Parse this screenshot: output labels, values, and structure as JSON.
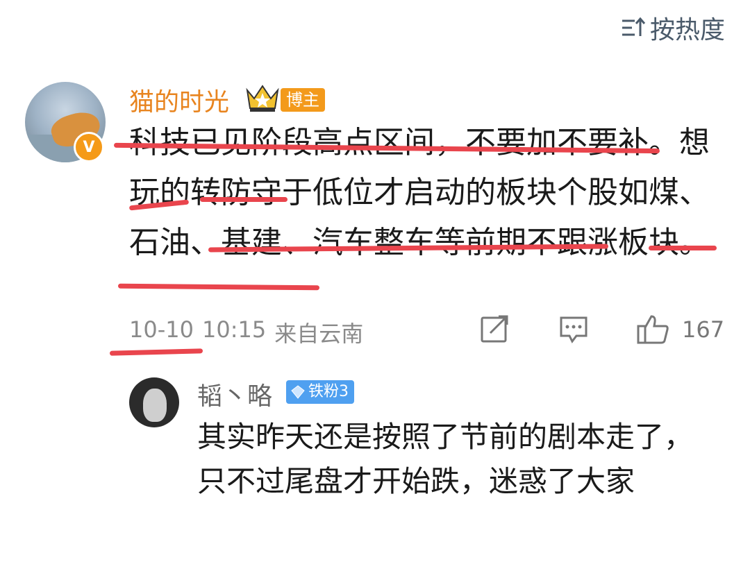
{
  "header": {
    "sort_label": "按热度",
    "sort_icon": "sort-icon"
  },
  "comment": {
    "username": "猫的时光",
    "verified_badge": "V",
    "role_tag": "博主",
    "text": "科技已见阶段高点区间，不要加不要补。想玩的转防守于低位才启动的板块个股如煤、石油、基建、汽车整车等前期不跟涨板块。",
    "date": "10-10",
    "time": "10:15",
    "location": "来自云南",
    "like_count": "167"
  },
  "reply": {
    "username": "韬丶略",
    "fan_tag": "铁粉3",
    "text": "其实昨天还是按照了节前的剧本走了，只不过尾盘才开始跌，迷惑了大家"
  },
  "colors": {
    "username": "#e8841f",
    "underline": "#e9454d",
    "blogger_tag": "#f39a1b",
    "fan_tag": "#4fa0f0"
  }
}
